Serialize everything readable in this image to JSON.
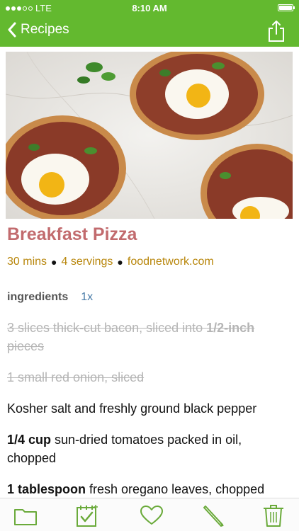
{
  "status_bar": {
    "carrier": "LTE",
    "time": "8:10 AM"
  },
  "nav": {
    "back_label": "Recipes"
  },
  "recipe": {
    "title": "Breakfast Pizza",
    "time": "30 mins",
    "servings": "4 servings",
    "source": "foodnetwork.com"
  },
  "ingredients_section": {
    "label": "ingredients",
    "scale": "1x"
  },
  "ingredients": [
    {
      "prefix": "3 slices thick-cut bacon, sliced into ",
      "bold": "1/2-inch",
      "suffix": " pieces",
      "done": true
    },
    {
      "prefix": "1 small red onion, sliced",
      "bold": "",
      "suffix": "",
      "done": true
    },
    {
      "prefix": "Kosher salt and freshly ground black pepper",
      "bold": "",
      "suffix": "",
      "done": false
    },
    {
      "prefix": "",
      "bold": "1/4 cup",
      "suffix": " sun-dried tomatoes packed in oil, chopped",
      "done": false
    },
    {
      "prefix": "",
      "bold": "1 tablespoon",
      "suffix": " fresh oregano leaves, chopped",
      "done": false
    }
  ],
  "colors": {
    "accent_green": "#63b92f",
    "title_red": "#c26b6e",
    "meta_gold": "#b8860b",
    "scale_blue": "#4a7ca8"
  },
  "tabs": [
    {
      "icon": "folder-icon"
    },
    {
      "icon": "calendar-check-icon"
    },
    {
      "icon": "heart-icon"
    },
    {
      "icon": "pencil-icon"
    },
    {
      "icon": "trash-icon"
    }
  ]
}
